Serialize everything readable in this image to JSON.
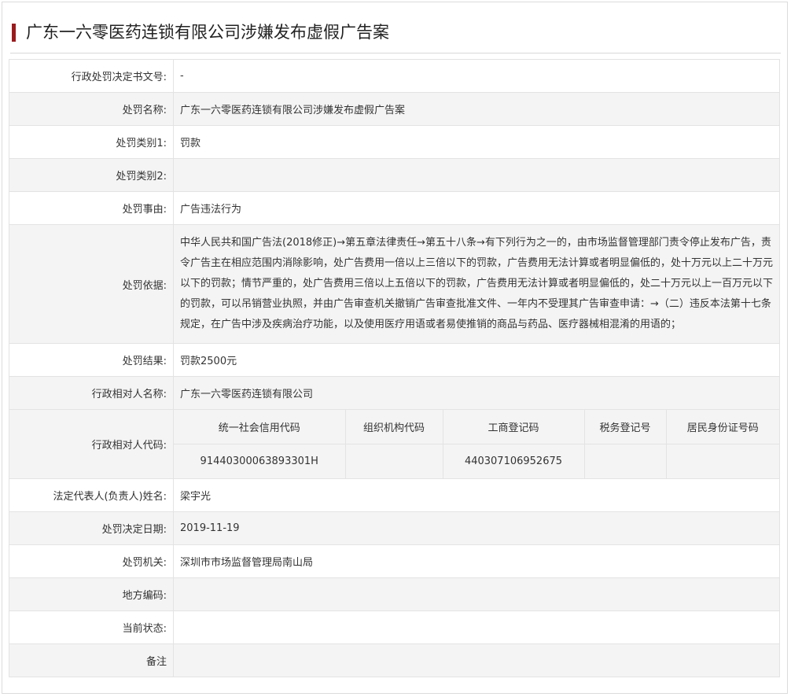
{
  "title": "广东一六零医药连锁有限公司涉嫌发布虚假广告案",
  "rows": {
    "decision_no": {
      "label": "行政处罚决定书文号:",
      "value": "-"
    },
    "penalty_name": {
      "label": "处罚名称:",
      "value": "广东一六零医药连锁有限公司涉嫌发布虚假广告案"
    },
    "category1": {
      "label": "处罚类别1:",
      "value": "罚款"
    },
    "category2": {
      "label": "处罚类别2:",
      "value": ""
    },
    "reason": {
      "label": "处罚事由:",
      "value": "广告违法行为"
    },
    "basis": {
      "label": "处罚依据:",
      "value": "中华人民共和国广告法(2018修正)→第五章法律责任→第五十八条→有下列行为之一的，由市场监督管理部门责令停止发布广告，责令广告主在相应范围内消除影响，处广告费用一倍以上三倍以下的罚款，广告费用无法计算或者明显偏低的，处十万元以上二十万元以下的罚款；情节严重的，处广告费用三倍以上五倍以下的罚款，广告费用无法计算或者明显偏低的，处二十万元以上一百万元以下的罚款，可以吊销营业执照，并由广告审查机关撤销广告审查批准文件、一年内不受理其广告审查申请：→（二）违反本法第十七条规定，在广告中涉及疾病治疗功能，以及使用医疗用语或者易使推销的商品与药品、医疗器械相混淆的用语的；"
    },
    "result": {
      "label": "处罚结果:",
      "value": "罚款2500元"
    },
    "party_name": {
      "label": "行政相对人名称:",
      "value": "广东一六零医药连锁有限公司"
    },
    "party_code": {
      "label": "行政相对人代码:",
      "headers": [
        "统一社会信用代码",
        "组织机构代码",
        "工商登记码",
        "税务登记号",
        "居民身份证号码"
      ],
      "values": [
        "91440300063893301H",
        "",
        "440307106952675",
        "",
        ""
      ]
    },
    "legal_rep": {
      "label": "法定代表人(负责人)姓名:",
      "value": "梁宇光"
    },
    "decision_date": {
      "label": "处罚决定日期:",
      "value": "2019-11-19"
    },
    "authority": {
      "label": "处罚机关:",
      "value": "深圳市市场监督管理局南山局"
    },
    "region_code": {
      "label": "地方编码:",
      "value": ""
    },
    "status": {
      "label": "当前状态:",
      "value": ""
    },
    "remark": {
      "label": "备注",
      "value": ""
    }
  },
  "colors": {
    "accent": "#9a1b1e",
    "row_alt": "#f4f4f4",
    "border": "#e3e3e3"
  }
}
